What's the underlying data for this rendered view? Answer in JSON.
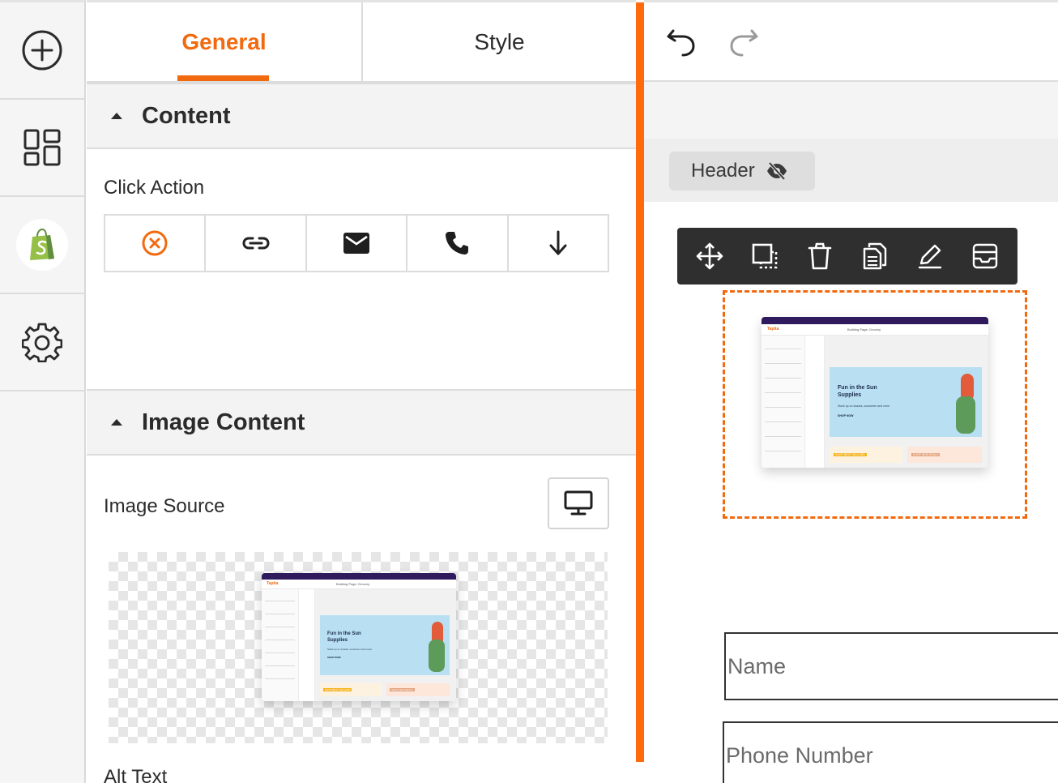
{
  "rail": {
    "items": [
      {
        "icon": "add-circle-icon"
      },
      {
        "icon": "layout-grid-icon"
      },
      {
        "icon": "shopify-bag-icon"
      },
      {
        "icon": "gear-icon"
      }
    ]
  },
  "panel": {
    "tabs": [
      {
        "label": "General",
        "active": true
      },
      {
        "label": "Style",
        "active": false
      }
    ],
    "content_section": {
      "title": "Content",
      "click_action_label": "Click Action",
      "actions": [
        "no-action-icon",
        "link-icon",
        "email-icon",
        "phone-icon",
        "download-icon"
      ]
    },
    "image_section": {
      "title": "Image Content",
      "image_source_label": "Image Source",
      "device_icon": "desktop-icon",
      "alt_text_label": "Alt Text"
    }
  },
  "thumbnail": {
    "brand": "Tapita",
    "page_title": "Building Page: Grocery",
    "hero_line1": "Fun in the Sun",
    "hero_line2": "Supplies",
    "hero_sub": "Stock up on snacks, sunscreen and more",
    "hero_cta": "SHOP NOW",
    "card1": "SHOP BEST SELLERS",
    "card2": "SHOP NEW DEALS"
  },
  "canvas": {
    "header_chip_label": "Header",
    "toolbar_icons": [
      "move-icon",
      "resize-icon",
      "trash-icon",
      "duplicate-icon",
      "edit-pen-icon",
      "save-inbox-icon"
    ],
    "form": {
      "name_placeholder": "Name",
      "phone_placeholder": "Phone Number"
    }
  },
  "colors": {
    "accent": "#f26a10",
    "divider": "#ff6a0e",
    "toolbar_bg": "#2f2f2f",
    "shopify_green": "#95bf47"
  }
}
